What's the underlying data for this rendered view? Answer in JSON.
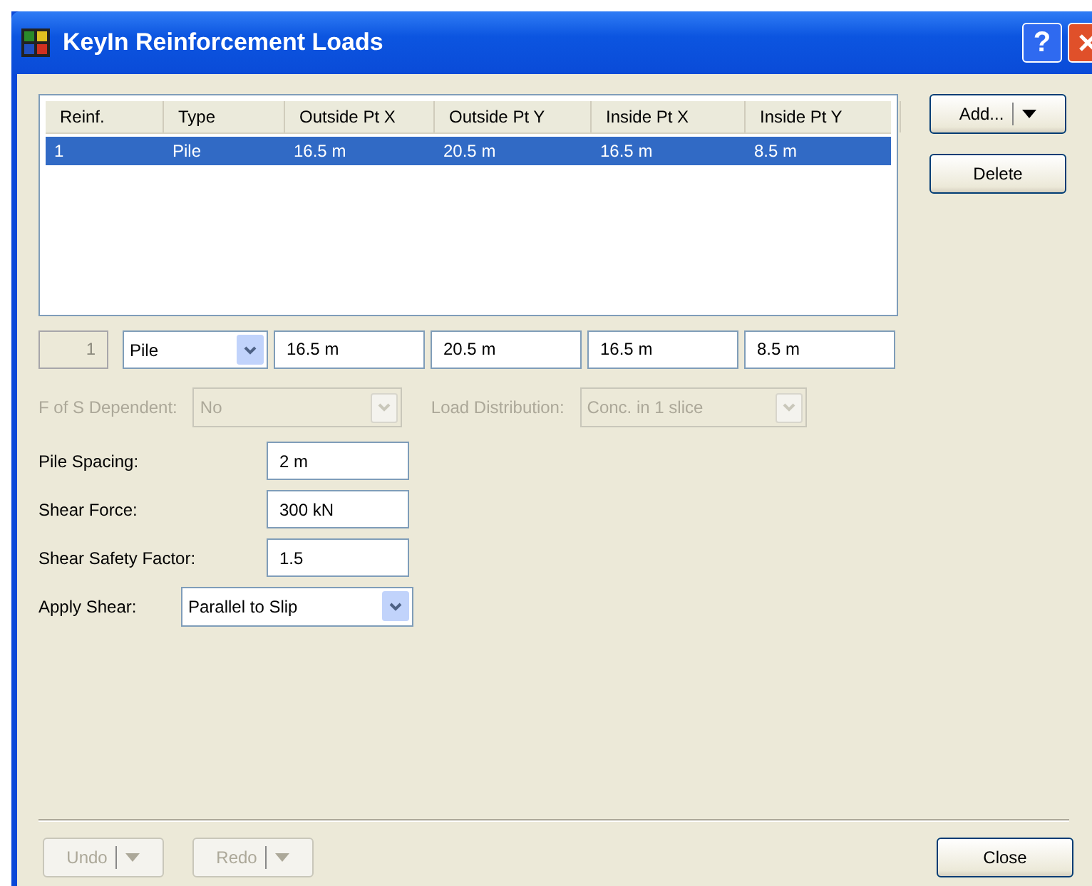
{
  "window": {
    "title": "KeyIn Reinforcement Loads",
    "help_button": "?"
  },
  "table": {
    "columns": [
      "Reinf.",
      "Type",
      "Outside Pt X",
      "Outside Pt Y",
      "Inside Pt X",
      "Inside Pt Y"
    ],
    "rows": [
      {
        "cells": [
          "1",
          "Pile",
          "16.5 m",
          "20.5 m",
          "16.5 m",
          "8.5 m"
        ],
        "selected": true
      }
    ]
  },
  "side_buttons": [
    {
      "label": "Add...",
      "kind": "split"
    },
    {
      "label": "Delete",
      "kind": "plain"
    }
  ],
  "edit_row": {
    "index": {
      "value": "1",
      "disabled": true
    },
    "type": {
      "value": "Pile"
    },
    "fields": [
      "16.5 m",
      "20.5 m",
      "16.5 m",
      "8.5 m"
    ]
  },
  "options": [
    {
      "label": "F of S Dependent:",
      "value": "No",
      "disabled": true
    },
    {
      "label": "Load Distribution:",
      "value": "Conc. in 1 slice",
      "disabled": true
    }
  ],
  "properties": [
    {
      "label": "Pile Spacing:",
      "value": "2 m",
      "kind": "text"
    },
    {
      "label": "Shear Force:",
      "value": "300 kN",
      "kind": "text"
    },
    {
      "label": "Shear Safety Factor:",
      "value": "1.5",
      "kind": "text"
    },
    {
      "label": "Apply Shear:",
      "value": "Parallel to Slip",
      "kind": "combo"
    }
  ],
  "footer_buttons": [
    {
      "label": "Undo",
      "disabled": true
    },
    {
      "label": "Redo",
      "disabled": true
    }
  ],
  "close_button": "Close"
}
